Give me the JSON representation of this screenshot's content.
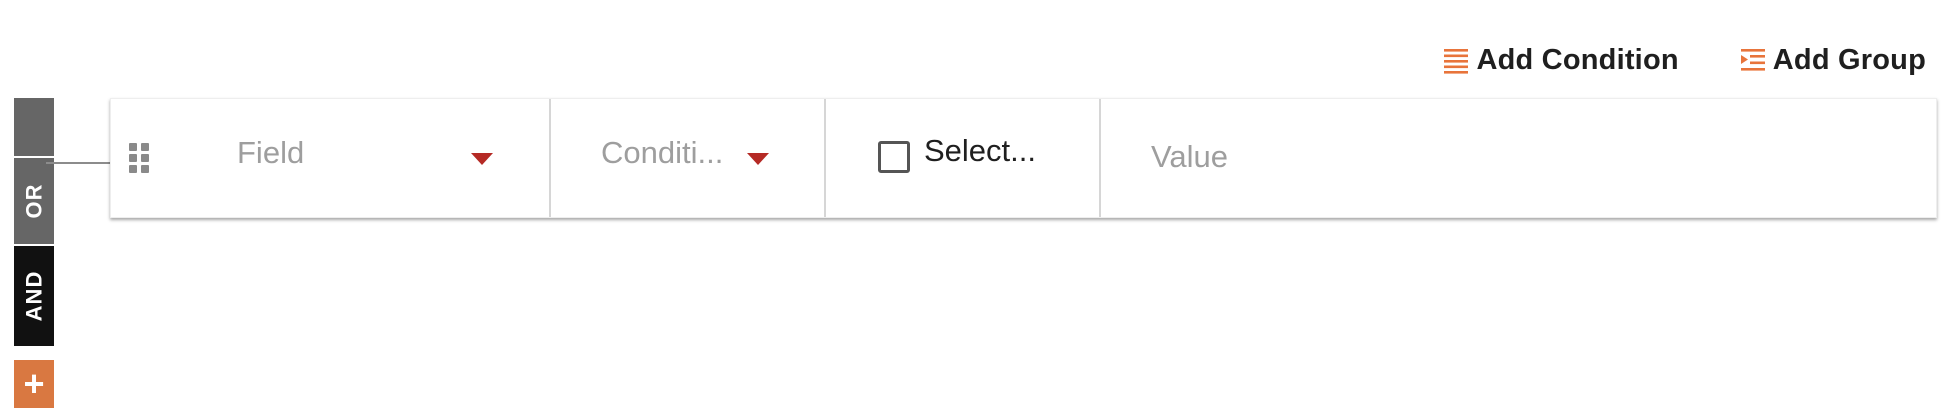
{
  "toolbar": {
    "add_condition_label": "Add Condition",
    "add_condition_icon": "list-lines-icon",
    "add_group_label": "Add Group",
    "add_group_icon": "indent-list-icon",
    "icon_color": "#e8743b"
  },
  "group_bar": {
    "or_label": "OR",
    "and_label": "AND",
    "add_label": "+",
    "or_color": "#666666",
    "and_color": "#111111",
    "add_color": "#d97841"
  },
  "condition_row": {
    "drag_icon": "drag-handle-icon",
    "field_placeholder": "Field",
    "condition_placeholder": "Conditi...",
    "select_label": "Select...",
    "value_placeholder": "Value",
    "caret_color": "#b52a25"
  }
}
